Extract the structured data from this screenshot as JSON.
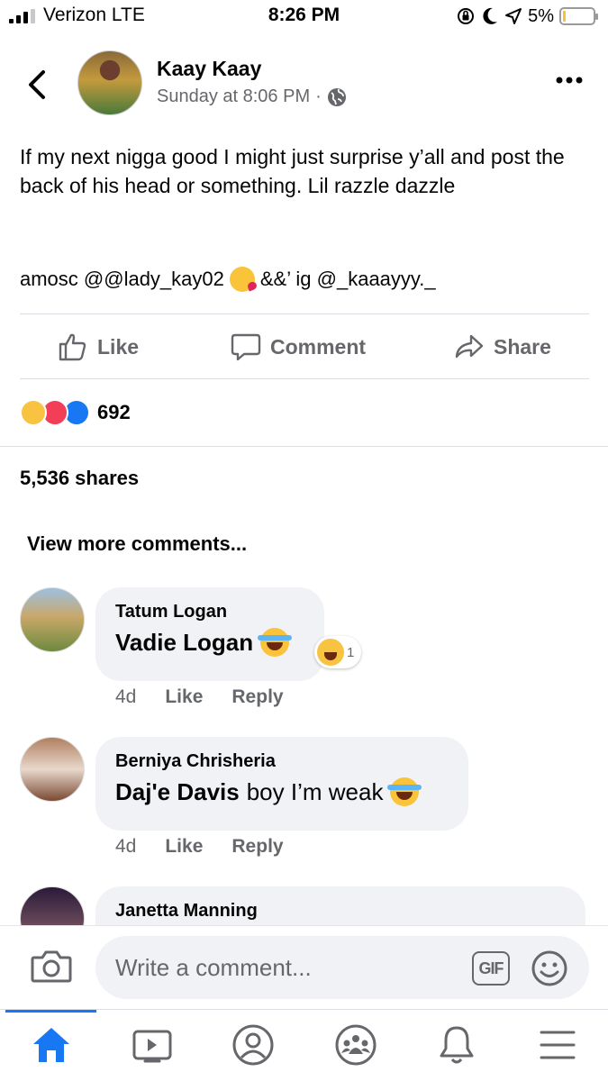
{
  "status_bar": {
    "carrier": "Verizon LTE",
    "time": "8:26 PM",
    "battery": "5%"
  },
  "post": {
    "author": "Kaay Kaay",
    "timestamp": "Sunday at 8:06 PM",
    "meta_separator": "·",
    "text": "If my next nigga good I might just surprise y’all and post the back of his head or something. Lil razzle dazzle",
    "tags_left": "amosc @@lady_kay02",
    "tags_right": "&&’ ig @_kaaayyy._",
    "actions": {
      "like": "Like",
      "comment": "Comment",
      "share": "Share"
    },
    "reaction_count": "692",
    "shares": "5,536 shares",
    "view_more": "View more comments..."
  },
  "comments": [
    {
      "name": "Tatum Logan",
      "mention": "Vadie Logan",
      "text": "",
      "age": "4d",
      "like": "Like",
      "reply": "Reply",
      "reaction_count": "1"
    },
    {
      "name": "Berniya Chrisheria",
      "mention": "Daj'e Davis",
      "text": "boy I’m weak",
      "age": "4d",
      "like": "Like",
      "reply": "Reply"
    },
    {
      "name": "Janetta Manning"
    }
  ],
  "composer": {
    "placeholder": "Write a comment...",
    "gif_label": "GIF"
  },
  "colors": {
    "accent": "#1877f2",
    "secondary_text": "#65676b",
    "bubble": "#f0f2f5"
  },
  "tabs": [
    "home-icon",
    "video-icon",
    "profile-icon",
    "groups-icon",
    "notifications-icon",
    "menu-icon"
  ]
}
